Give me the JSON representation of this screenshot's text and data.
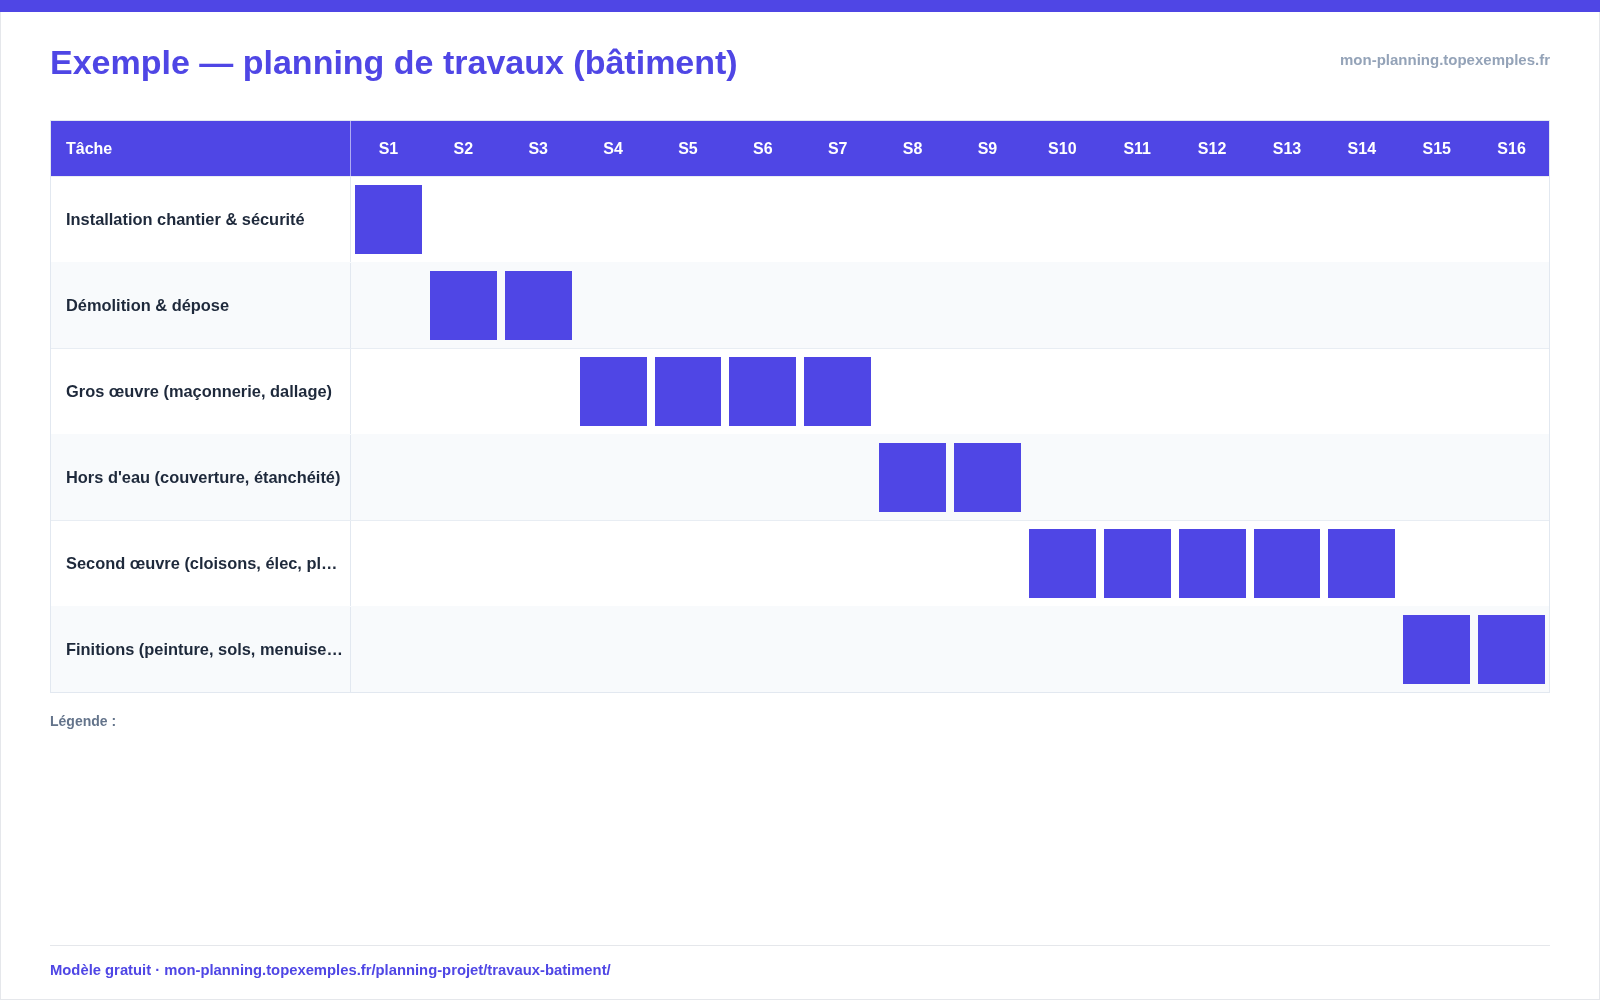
{
  "header": {
    "title": "Exemple — planning de travaux (bâtiment)",
    "site": "mon-planning.topexemples.fr"
  },
  "table": {
    "task_column": "Tâche",
    "weeks": [
      "S1",
      "S2",
      "S3",
      "S4",
      "S5",
      "S6",
      "S7",
      "S8",
      "S9",
      "S10",
      "S11",
      "S12",
      "S13",
      "S14",
      "S15",
      "S16"
    ],
    "rows": [
      {
        "task": "Installation chantier & sécurité",
        "cells": [
          {
            "kind": "block"
          },
          {
            "kind": "empty"
          },
          {
            "kind": "empty"
          },
          {
            "kind": "empty"
          },
          {
            "kind": "empty"
          },
          {
            "kind": "empty"
          },
          {
            "kind": "empty"
          },
          {
            "kind": "empty"
          },
          {
            "kind": "empty"
          },
          {
            "kind": "empty"
          },
          {
            "kind": "empty"
          },
          {
            "kind": "empty"
          },
          {
            "kind": "empty"
          },
          {
            "kind": "empty"
          },
          {
            "kind": "empty"
          },
          {
            "kind": "empty"
          }
        ]
      },
      {
        "task": "Démolition & dépose",
        "cells": [
          {
            "kind": "empty"
          },
          {
            "kind": "block"
          },
          {
            "kind": "block"
          },
          {
            "kind": "empty"
          },
          {
            "kind": "empty"
          },
          {
            "kind": "empty"
          },
          {
            "kind": "empty"
          },
          {
            "kind": "empty"
          },
          {
            "kind": "empty"
          },
          {
            "kind": "empty"
          },
          {
            "kind": "empty"
          },
          {
            "kind": "empty"
          },
          {
            "kind": "empty"
          },
          {
            "kind": "empty"
          },
          {
            "kind": "empty"
          },
          {
            "kind": "empty"
          }
        ]
      },
      {
        "task": "Gros œuvre (maçonnerie, dallage)",
        "cells": [
          {
            "kind": "empty"
          },
          {
            "kind": "empty"
          },
          {
            "kind": "empty"
          },
          {
            "kind": "block"
          },
          {
            "kind": "block"
          },
          {
            "kind": "block"
          },
          {
            "kind": "block"
          },
          {
            "kind": "empty"
          },
          {
            "kind": "empty"
          },
          {
            "kind": "empty"
          },
          {
            "kind": "empty"
          },
          {
            "kind": "empty"
          },
          {
            "kind": "empty"
          },
          {
            "kind": "empty"
          },
          {
            "kind": "empty"
          },
          {
            "kind": "empty"
          }
        ]
      },
      {
        "task": "Hors d'eau (couverture, étanchéité)",
        "cells": [
          {
            "kind": "empty"
          },
          {
            "kind": "empty"
          },
          {
            "kind": "empty"
          },
          {
            "kind": "empty"
          },
          {
            "kind": "empty"
          },
          {
            "kind": "empty"
          },
          {
            "kind": "empty"
          },
          {
            "kind": "block"
          },
          {
            "kind": "block"
          },
          {
            "kind": "empty"
          },
          {
            "kind": "empty"
          },
          {
            "kind": "empty"
          },
          {
            "kind": "empty"
          },
          {
            "kind": "empty"
          },
          {
            "kind": "empty"
          },
          {
            "kind": "empty"
          }
        ]
      },
      {
        "task": "Second œuvre (cloisons, élec, pl…",
        "cells": [
          {
            "kind": "empty"
          },
          {
            "kind": "empty"
          },
          {
            "kind": "empty"
          },
          {
            "kind": "empty"
          },
          {
            "kind": "empty"
          },
          {
            "kind": "empty"
          },
          {
            "kind": "empty"
          },
          {
            "kind": "empty"
          },
          {
            "kind": "empty"
          },
          {
            "kind": "block"
          },
          {
            "kind": "block"
          },
          {
            "kind": "block"
          },
          {
            "kind": "block"
          },
          {
            "kind": "block"
          },
          {
            "kind": "empty"
          },
          {
            "kind": "empty"
          }
        ]
      },
      {
        "task": "Finitions (peinture, sols, menuise…",
        "cells": [
          {
            "kind": "empty"
          },
          {
            "kind": "empty"
          },
          {
            "kind": "empty"
          },
          {
            "kind": "empty"
          },
          {
            "kind": "empty"
          },
          {
            "kind": "empty"
          },
          {
            "kind": "empty"
          },
          {
            "kind": "empty"
          },
          {
            "kind": "empty"
          },
          {
            "kind": "empty"
          },
          {
            "kind": "empty"
          },
          {
            "kind": "empty"
          },
          {
            "kind": "empty"
          },
          {
            "kind": "empty"
          },
          {
            "kind": "block"
          },
          {
            "kind": "block"
          }
        ]
      }
    ]
  },
  "legend": {
    "label": "Légende :"
  },
  "footer": {
    "text": "Modèle gratuit · mon-planning.topexemples.fr/planning-projet/travaux-batiment/"
  }
}
